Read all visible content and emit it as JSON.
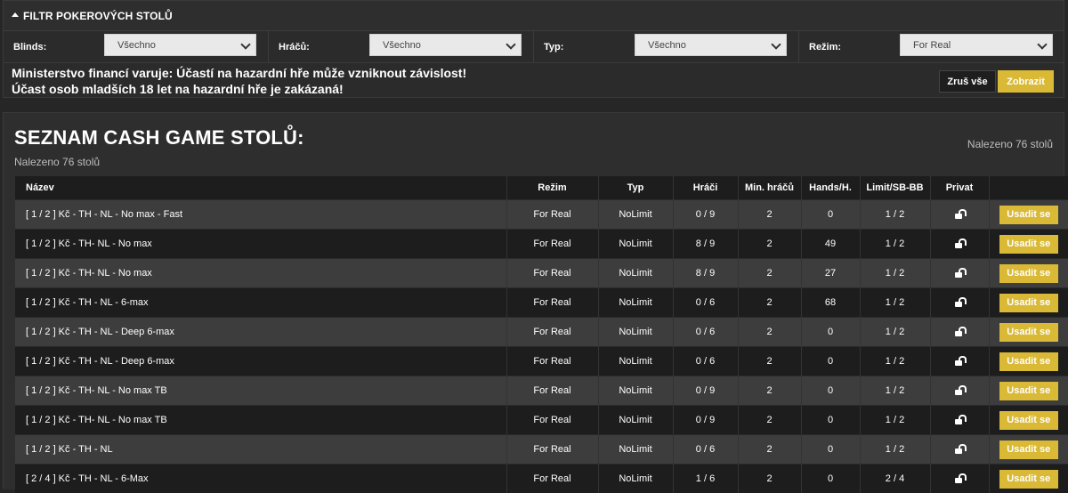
{
  "filter": {
    "title": "FILTR POKEROVÝCH STOLŮ",
    "fields": [
      {
        "label": "Blinds:",
        "value": "Všechno"
      },
      {
        "label": "Hráčů:",
        "value": "Všechno"
      },
      {
        "label": "Typ:",
        "value": "Všechno"
      },
      {
        "label": "Režim:",
        "value": "For Real"
      }
    ],
    "warning_line1": "Ministerstvo financí varuje: Účastí na hazardní hře může vzniknout závislost!",
    "warning_line2": "Účast osob mladších 18 let na hazardní hře je zakázaná!",
    "clear_label": "Zruš vše",
    "show_label": "Zobrazit"
  },
  "list": {
    "title": "SEZNAM CASH GAME STOLŮ:",
    "count_text": "Nalezeno 76 stolů",
    "count_text_right": "Nalezeno 76 stolů",
    "columns": [
      "Název",
      "Režim",
      "Typ",
      "Hráči",
      "Min. hráčů",
      "Hands/H.",
      "Limit/SB-BB",
      "Privat",
      ""
    ],
    "rows": [
      {
        "name": "[ 1 / 2 ] Kč - TH - NL - No max - Fast",
        "mode": "For Real",
        "type": "NoLimit",
        "players": "0 / 9",
        "min": "2",
        "hands": "0",
        "limit": "1 / 2",
        "action": "Usadit se"
      },
      {
        "name": "[ 1 / 2 ] Kč - TH- NL - No max",
        "mode": "For Real",
        "type": "NoLimit",
        "players": "8 / 9",
        "min": "2",
        "hands": "49",
        "limit": "1 / 2",
        "action": "Usadit se"
      },
      {
        "name": "[ 1 / 2 ] Kč - TH- NL - No max",
        "mode": "For Real",
        "type": "NoLimit",
        "players": "8 / 9",
        "min": "2",
        "hands": "27",
        "limit": "1 / 2",
        "action": "Usadit se"
      },
      {
        "name": "[ 1 / 2 ] Kč - TH - NL - 6-max",
        "mode": "For Real",
        "type": "NoLimit",
        "players": "0 / 6",
        "min": "2",
        "hands": "68",
        "limit": "1 / 2",
        "action": "Usadit se"
      },
      {
        "name": "[ 1 / 2 ] Kč - TH - NL - Deep 6-max",
        "mode": "For Real",
        "type": "NoLimit",
        "players": "0 / 6",
        "min": "2",
        "hands": "0",
        "limit": "1 / 2",
        "action": "Usadit se"
      },
      {
        "name": "[ 1 / 2 ] Kč - TH - NL - Deep 6-max",
        "mode": "For Real",
        "type": "NoLimit",
        "players": "0 / 6",
        "min": "2",
        "hands": "0",
        "limit": "1 / 2",
        "action": "Usadit se"
      },
      {
        "name": "[ 1 / 2 ] Kč - TH- NL - No max TB",
        "mode": "For Real",
        "type": "NoLimit",
        "players": "0 / 9",
        "min": "2",
        "hands": "0",
        "limit": "1 / 2",
        "action": "Usadit se"
      },
      {
        "name": "[ 1 / 2 ] Kč - TH- NL - No max TB",
        "mode": "For Real",
        "type": "NoLimit",
        "players": "0 / 9",
        "min": "2",
        "hands": "0",
        "limit": "1 / 2",
        "action": "Usadit se"
      },
      {
        "name": "[ 1 / 2 ] Kč - TH - NL",
        "mode": "For Real",
        "type": "NoLimit",
        "players": "0 / 6",
        "min": "2",
        "hands": "0",
        "limit": "1 / 2",
        "action": "Usadit se"
      },
      {
        "name": "[ 2 / 4 ] Kč - TH - NL - 6-Max",
        "mode": "For Real",
        "type": "NoLimit",
        "players": "1 / 6",
        "min": "2",
        "hands": "0",
        "limit": "2 / 4",
        "action": "Usadit se"
      }
    ]
  }
}
